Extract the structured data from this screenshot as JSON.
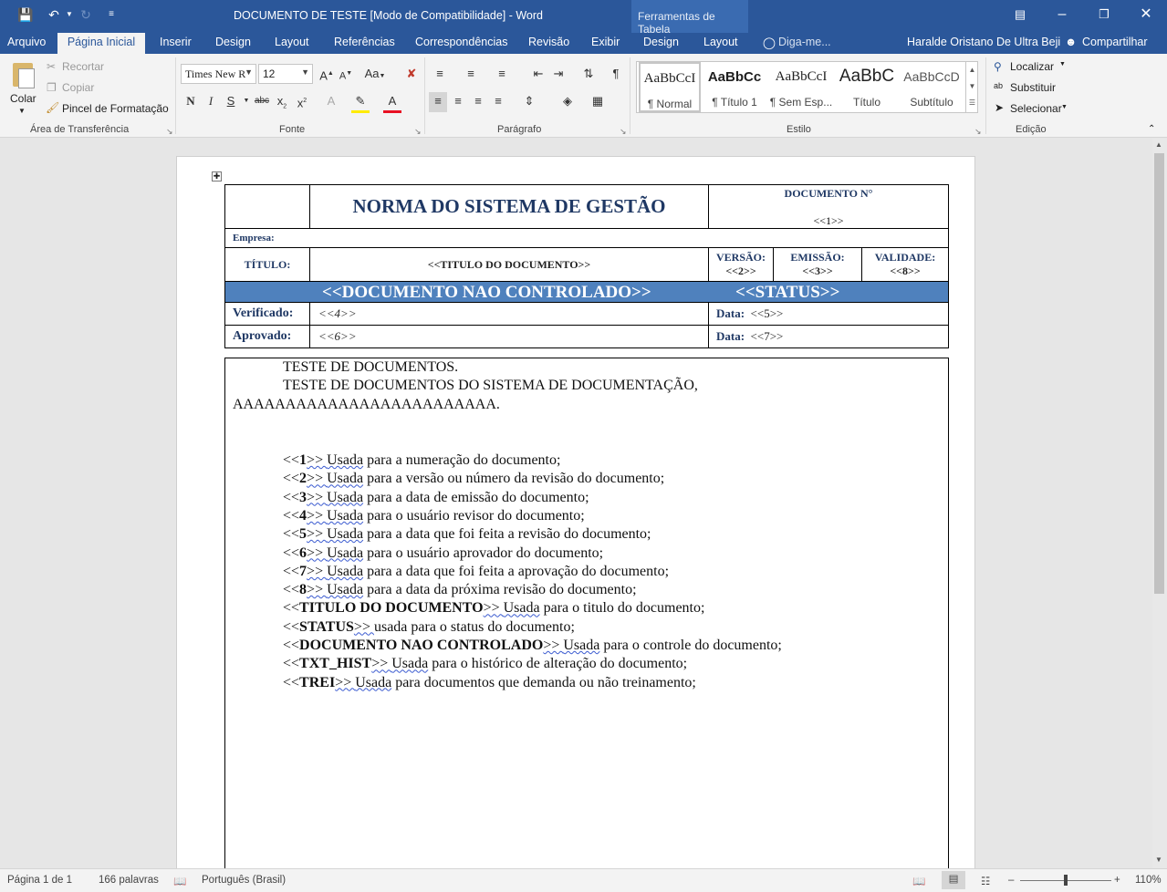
{
  "window": {
    "title": "DOCUMENTO DE TESTE [Modo de Compatibilidade] - Word",
    "contextual_group": "Ferramentas de Tabela",
    "user": "Haralde Oristano De Ultra Beji",
    "share": "Compartilhar",
    "tell_me": "Diga-me..."
  },
  "tabs": [
    "Arquivo",
    "Página Inicial",
    "Inserir",
    "Design",
    "Layout",
    "Referências",
    "Correspondências",
    "Revisão",
    "Exibir",
    "Design",
    "Layout"
  ],
  "ribbon": {
    "clipboard": {
      "label": "Área de Transferência",
      "paste": "Colar",
      "cut": "Recortar",
      "copy": "Copiar",
      "format_painter": "Pincel de Formatação"
    },
    "font": {
      "label": "Fonte",
      "font_name": "Times New R",
      "font_size": "12",
      "case": "Aa"
    },
    "paragraph": {
      "label": "Parágrafo"
    },
    "styles": {
      "label": "Estilo",
      "items": [
        {
          "sample": "AaBbCcI",
          "name": "¶ Normal"
        },
        {
          "sample": "AaBbCc",
          "name": "¶ Título 1"
        },
        {
          "sample": "AaBbCcI",
          "name": "¶ Sem Esp..."
        },
        {
          "sample": "AaBbC",
          "name": "Título"
        },
        {
          "sample": "AaBbCcD",
          "name": "Subtítulo"
        }
      ]
    },
    "editing": {
      "label": "Edição",
      "find": "Localizar",
      "replace": "Substituir",
      "select": "Selecionar"
    }
  },
  "document": {
    "header": {
      "norma": "NORMA DO SISTEMA DE GESTÃO",
      "doc_no_label": "DOCUMENTO N°",
      "doc_no": "<<1>>",
      "empresa": "Empresa:",
      "titulo_label": "TÍTULO:",
      "titulo": "<<TITULO DO DOCUMENTO>>",
      "versao_label": "VERSÃO:",
      "versao": "<<2>>",
      "emissao_label": "EMISSÃO:",
      "emissao": "<<3>>",
      "validade_label": "VALIDADE:",
      "validade": "<<8>>",
      "banner_left": "<<DOCUMENTO NAO CONTROLADO>>",
      "banner_right": "<<STATUS>>",
      "verificado_label": "Verificado:",
      "verificado": "<<4>>",
      "data1_label": "Data:",
      "data1": "<<5>>",
      "aprovado_label": "Aprovado:",
      "aprovado": "<<6>>",
      "data2_label": "Data:",
      "data2": "<<7>>"
    },
    "body": {
      "p1": "TESTE DE DOCUMENTOS.",
      "p2a": "TESTE DE DOCUMENTOS DO SISTEMA DE DOCUMENTAÇÃO,",
      "p2b": "AAAAAAAAAAAAAAAAAAAAAAAAA.",
      "items": [
        {
          "pre": "<<",
          "key": "1",
          "post": ">> ",
          "link": "Usada",
          "rest": " para a numeração do documento;"
        },
        {
          "pre": "<<",
          "key": "2",
          "post": ">> ",
          "link": "Usada",
          "rest": " para a versão ou número da revisão do documento;"
        },
        {
          "pre": "<<",
          "key": "3",
          "post": ">> ",
          "link": "Usada",
          "rest": " para a data de emissão do documento;"
        },
        {
          "pre": "<<",
          "key": "4",
          "post": ">> ",
          "link": "Usada",
          "rest": " para o usuário revisor do documento;"
        },
        {
          "pre": "<<",
          "key": "5",
          "post": ">> ",
          "link": "Usada",
          "rest": " para a data que foi feita a revisão do documento;"
        },
        {
          "pre": "<<",
          "key": "6",
          "post": ">> ",
          "link": "Usada",
          "rest": " para o usuário aprovador do documento;"
        },
        {
          "pre": "<<",
          "key": "7",
          "post": ">> ",
          "link": "Usada",
          "rest": " para a data que foi feita a aprovação do documento;"
        },
        {
          "pre": "<<",
          "key": "8",
          "post": ">> ",
          "link": "Usada",
          "rest": " para a data da próxima revisão do documento;"
        },
        {
          "pre": "<<",
          "key": "TITULO DO DOCUMENTO",
          "post": ">> ",
          "link": "Usada",
          "rest": " para o titulo do documento;"
        },
        {
          "pre": "<<",
          "key": "STATUS",
          "post": ">> ",
          "link": "",
          "rest": "usada para o status do documento;"
        },
        {
          "pre": "<<",
          "key": "DOCUMENTO NAO CONTROLADO",
          "post": ">> ",
          "link": "Usada",
          "rest": " para o controle do documento;"
        },
        {
          "pre": "<<",
          "key": "TXT_HIST",
          "post": ">> ",
          "link": "Usada",
          "rest": " para o histórico de alteração do documento;"
        },
        {
          "pre": "<<",
          "key": "TREI",
          "post": ">> ",
          "link": "Usada",
          "rest": " para documentos que demanda ou não treinamento;"
        }
      ]
    }
  },
  "status": {
    "page": "Página 1 de 1",
    "words": "166 palavras",
    "language": "Português (Brasil)",
    "zoom": "110%"
  },
  "colors": {
    "accent": "#2b579a",
    "banner": "#4f81bd",
    "header_text": "#1f3864"
  }
}
